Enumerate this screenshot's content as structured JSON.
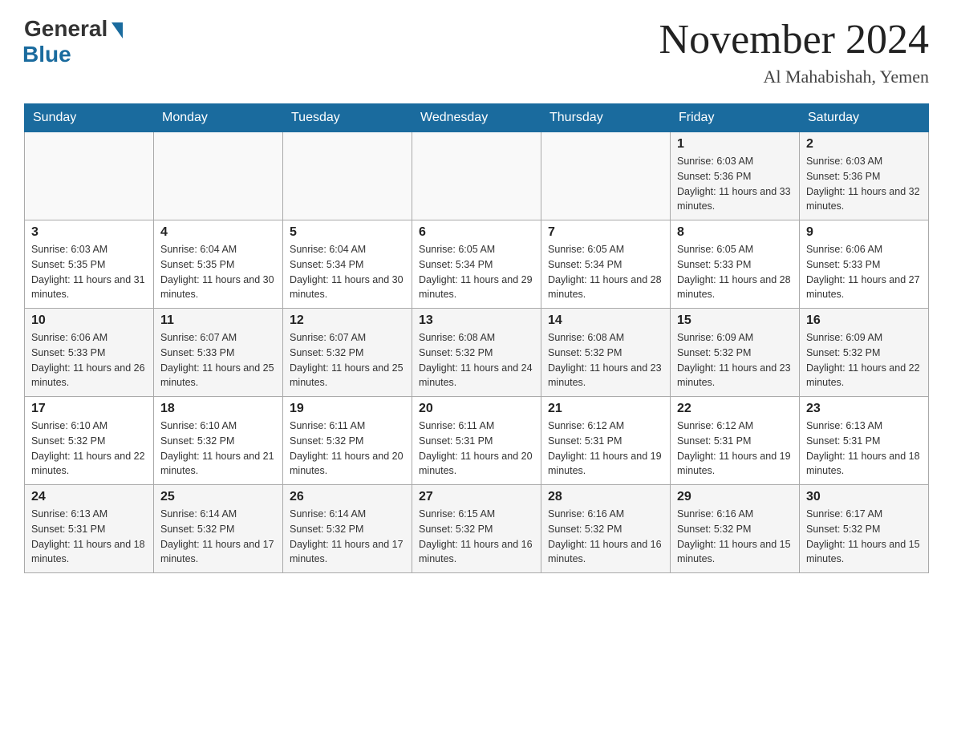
{
  "header": {
    "logo_general": "General",
    "logo_blue": "Blue",
    "month_title": "November 2024",
    "location": "Al Mahabishah, Yemen"
  },
  "calendar": {
    "days_of_week": [
      "Sunday",
      "Monday",
      "Tuesday",
      "Wednesday",
      "Thursday",
      "Friday",
      "Saturday"
    ],
    "weeks": [
      [
        {
          "day": "",
          "sunrise": "",
          "sunset": "",
          "daylight": ""
        },
        {
          "day": "",
          "sunrise": "",
          "sunset": "",
          "daylight": ""
        },
        {
          "day": "",
          "sunrise": "",
          "sunset": "",
          "daylight": ""
        },
        {
          "day": "",
          "sunrise": "",
          "sunset": "",
          "daylight": ""
        },
        {
          "day": "",
          "sunrise": "",
          "sunset": "",
          "daylight": ""
        },
        {
          "day": "1",
          "sunrise": "Sunrise: 6:03 AM",
          "sunset": "Sunset: 5:36 PM",
          "daylight": "Daylight: 11 hours and 33 minutes."
        },
        {
          "day": "2",
          "sunrise": "Sunrise: 6:03 AM",
          "sunset": "Sunset: 5:36 PM",
          "daylight": "Daylight: 11 hours and 32 minutes."
        }
      ],
      [
        {
          "day": "3",
          "sunrise": "Sunrise: 6:03 AM",
          "sunset": "Sunset: 5:35 PM",
          "daylight": "Daylight: 11 hours and 31 minutes."
        },
        {
          "day": "4",
          "sunrise": "Sunrise: 6:04 AM",
          "sunset": "Sunset: 5:35 PM",
          "daylight": "Daylight: 11 hours and 30 minutes."
        },
        {
          "day": "5",
          "sunrise": "Sunrise: 6:04 AM",
          "sunset": "Sunset: 5:34 PM",
          "daylight": "Daylight: 11 hours and 30 minutes."
        },
        {
          "day": "6",
          "sunrise": "Sunrise: 6:05 AM",
          "sunset": "Sunset: 5:34 PM",
          "daylight": "Daylight: 11 hours and 29 minutes."
        },
        {
          "day": "7",
          "sunrise": "Sunrise: 6:05 AM",
          "sunset": "Sunset: 5:34 PM",
          "daylight": "Daylight: 11 hours and 28 minutes."
        },
        {
          "day": "8",
          "sunrise": "Sunrise: 6:05 AM",
          "sunset": "Sunset: 5:33 PM",
          "daylight": "Daylight: 11 hours and 28 minutes."
        },
        {
          "day": "9",
          "sunrise": "Sunrise: 6:06 AM",
          "sunset": "Sunset: 5:33 PM",
          "daylight": "Daylight: 11 hours and 27 minutes."
        }
      ],
      [
        {
          "day": "10",
          "sunrise": "Sunrise: 6:06 AM",
          "sunset": "Sunset: 5:33 PM",
          "daylight": "Daylight: 11 hours and 26 minutes."
        },
        {
          "day": "11",
          "sunrise": "Sunrise: 6:07 AM",
          "sunset": "Sunset: 5:33 PM",
          "daylight": "Daylight: 11 hours and 25 minutes."
        },
        {
          "day": "12",
          "sunrise": "Sunrise: 6:07 AM",
          "sunset": "Sunset: 5:32 PM",
          "daylight": "Daylight: 11 hours and 25 minutes."
        },
        {
          "day": "13",
          "sunrise": "Sunrise: 6:08 AM",
          "sunset": "Sunset: 5:32 PM",
          "daylight": "Daylight: 11 hours and 24 minutes."
        },
        {
          "day": "14",
          "sunrise": "Sunrise: 6:08 AM",
          "sunset": "Sunset: 5:32 PM",
          "daylight": "Daylight: 11 hours and 23 minutes."
        },
        {
          "day": "15",
          "sunrise": "Sunrise: 6:09 AM",
          "sunset": "Sunset: 5:32 PM",
          "daylight": "Daylight: 11 hours and 23 minutes."
        },
        {
          "day": "16",
          "sunrise": "Sunrise: 6:09 AM",
          "sunset": "Sunset: 5:32 PM",
          "daylight": "Daylight: 11 hours and 22 minutes."
        }
      ],
      [
        {
          "day": "17",
          "sunrise": "Sunrise: 6:10 AM",
          "sunset": "Sunset: 5:32 PM",
          "daylight": "Daylight: 11 hours and 22 minutes."
        },
        {
          "day": "18",
          "sunrise": "Sunrise: 6:10 AM",
          "sunset": "Sunset: 5:32 PM",
          "daylight": "Daylight: 11 hours and 21 minutes."
        },
        {
          "day": "19",
          "sunrise": "Sunrise: 6:11 AM",
          "sunset": "Sunset: 5:32 PM",
          "daylight": "Daylight: 11 hours and 20 minutes."
        },
        {
          "day": "20",
          "sunrise": "Sunrise: 6:11 AM",
          "sunset": "Sunset: 5:31 PM",
          "daylight": "Daylight: 11 hours and 20 minutes."
        },
        {
          "day": "21",
          "sunrise": "Sunrise: 6:12 AM",
          "sunset": "Sunset: 5:31 PM",
          "daylight": "Daylight: 11 hours and 19 minutes."
        },
        {
          "day": "22",
          "sunrise": "Sunrise: 6:12 AM",
          "sunset": "Sunset: 5:31 PM",
          "daylight": "Daylight: 11 hours and 19 minutes."
        },
        {
          "day": "23",
          "sunrise": "Sunrise: 6:13 AM",
          "sunset": "Sunset: 5:31 PM",
          "daylight": "Daylight: 11 hours and 18 minutes."
        }
      ],
      [
        {
          "day": "24",
          "sunrise": "Sunrise: 6:13 AM",
          "sunset": "Sunset: 5:31 PM",
          "daylight": "Daylight: 11 hours and 18 minutes."
        },
        {
          "day": "25",
          "sunrise": "Sunrise: 6:14 AM",
          "sunset": "Sunset: 5:32 PM",
          "daylight": "Daylight: 11 hours and 17 minutes."
        },
        {
          "day": "26",
          "sunrise": "Sunrise: 6:14 AM",
          "sunset": "Sunset: 5:32 PM",
          "daylight": "Daylight: 11 hours and 17 minutes."
        },
        {
          "day": "27",
          "sunrise": "Sunrise: 6:15 AM",
          "sunset": "Sunset: 5:32 PM",
          "daylight": "Daylight: 11 hours and 16 minutes."
        },
        {
          "day": "28",
          "sunrise": "Sunrise: 6:16 AM",
          "sunset": "Sunset: 5:32 PM",
          "daylight": "Daylight: 11 hours and 16 minutes."
        },
        {
          "day": "29",
          "sunrise": "Sunrise: 6:16 AM",
          "sunset": "Sunset: 5:32 PM",
          "daylight": "Daylight: 11 hours and 15 minutes."
        },
        {
          "day": "30",
          "sunrise": "Sunrise: 6:17 AM",
          "sunset": "Sunset: 5:32 PM",
          "daylight": "Daylight: 11 hours and 15 minutes."
        }
      ]
    ]
  }
}
